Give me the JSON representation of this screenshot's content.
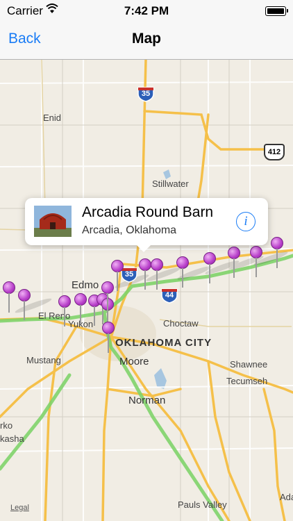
{
  "status_bar": {
    "carrier": "Carrier",
    "time": "7:42 PM"
  },
  "nav": {
    "back_label": "Back",
    "title": "Map"
  },
  "map": {
    "places": {
      "enid": "Enid",
      "stillwater": "Stillwater",
      "edmond": "Edmo",
      "el_reno": "El Reno",
      "yukon": "Yukon",
      "choctaw": "Choctaw",
      "oklahoma_city": "OKLAHOMA CITY",
      "mustang": "Mustang",
      "moore": "Moore",
      "shawnee": "Shawnee",
      "tecumseh": "Tecumseh",
      "norman": "Norman",
      "chickasha_partial": "rko",
      "chickasha2_partial": "kasha",
      "pauls_valley": "Pauls Valley",
      "ada_partial": "Ada"
    },
    "shields": {
      "i35_north": "35",
      "i35_edmond": "35",
      "i44": "44",
      "us412": "412"
    },
    "legal_label": "Legal"
  },
  "callout": {
    "name": "Arcadia Round Barn",
    "location": "Arcadia, Oklahoma"
  },
  "colors": {
    "accent": "#1a7cf5",
    "pin": "#b73ec9",
    "route": "#7fd36a",
    "highway": "#f5c04a"
  }
}
